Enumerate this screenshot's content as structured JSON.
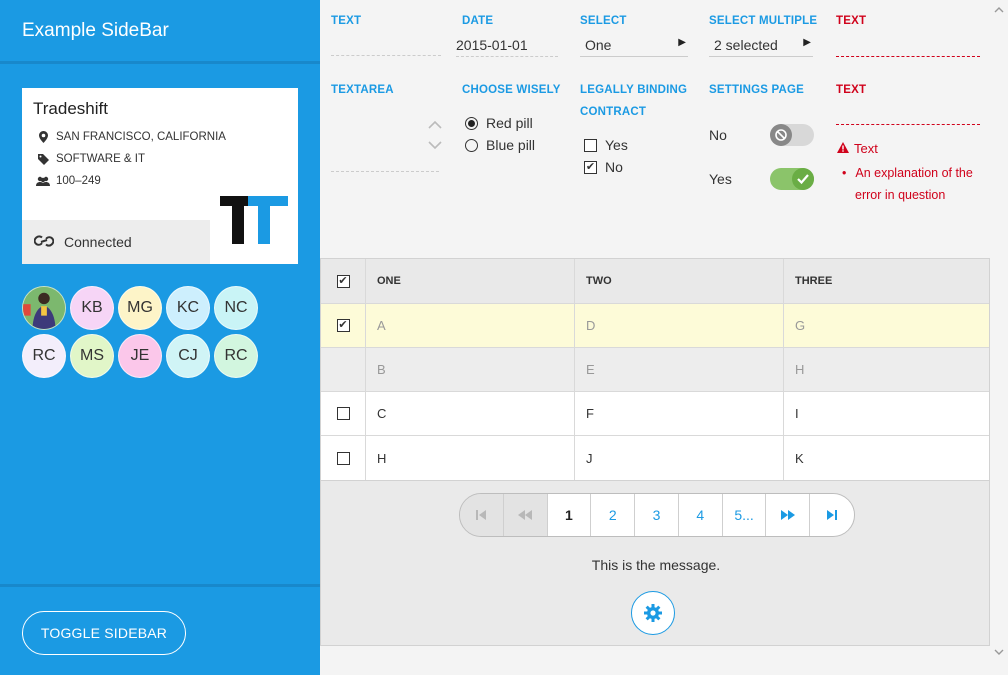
{
  "sidebar": {
    "title": "Example SideBar",
    "company": {
      "name": "Tradeshift",
      "location": "SAN FRANCISCO, CALIFORNIA",
      "industry": "SOFTWARE & IT",
      "size": "100–249",
      "status": "Connected"
    },
    "avatars": [
      {
        "initials": "",
        "color": "#7cb86e",
        "photo": true
      },
      {
        "initials": "KB",
        "color": "#f6d5f6"
      },
      {
        "initials": "MG",
        "color": "#fdf4c8"
      },
      {
        "initials": "KC",
        "color": "#cdeffd"
      },
      {
        "initials": "NC",
        "color": "#c9f4f6"
      },
      {
        "initials": "RC",
        "color": "#f3eefb"
      },
      {
        "initials": "MS",
        "color": "#e1f6c8"
      },
      {
        "initials": "JE",
        "color": "#fbc7ea"
      },
      {
        "initials": "CJ",
        "color": "#d0f4f6"
      },
      {
        "initials": "RC",
        "color": "#d2f6df"
      }
    ],
    "toggle_label": "TOGGLE SIDEBAR"
  },
  "form": {
    "text_label": "TEXT",
    "date_label": "DATE",
    "date_value": "2015-01-01",
    "select_label": "SELECT",
    "select_value": "One",
    "select_multiple_label": "SELECT MULTIPLE",
    "select_multiple_value": "2 selected",
    "text_error_label_1": "TEXT",
    "textarea_label": "TEXTAREA",
    "choose_label": "CHOOSE WISELY",
    "radio_red": "Red pill",
    "radio_blue": "Blue pill",
    "legal_label_1": "LEGALLY BINDING",
    "legal_label_2": "CONTRACT",
    "check_yes": "Yes",
    "check_no": "No",
    "settings_label": "SETTINGS PAGE",
    "switch_no": "No",
    "switch_yes": "Yes",
    "text_error_label_2": "TEXT",
    "error_title": "Text",
    "error_detail_1": "An explanation of the",
    "error_detail_2": "error in question"
  },
  "table": {
    "headers": [
      "ONE",
      "TWO",
      "THREE"
    ],
    "rows": [
      [
        "A",
        "D",
        "G"
      ],
      [
        "B",
        "E",
        "H"
      ],
      [
        "C",
        "F",
        "I"
      ],
      [
        "H",
        "J",
        "K"
      ]
    ]
  },
  "pager": {
    "pages": [
      "1",
      "2",
      "3",
      "4",
      "5..."
    ],
    "current": "1"
  },
  "message": "This is the message.",
  "colors": {
    "accent": "#1b9ae3",
    "error": "#d0021b",
    "switch_on": "#8bc46a",
    "selected_row": "#fdfbd8"
  }
}
